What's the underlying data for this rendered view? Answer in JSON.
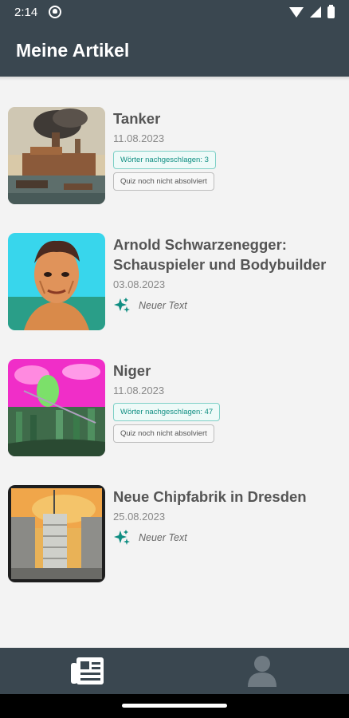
{
  "status_bar": {
    "time": "2:14"
  },
  "app_bar": {
    "title": "Meine Artikel"
  },
  "articles": [
    {
      "title": "Tanker",
      "date": "11.08.2023",
      "lookups": "Wörter nachgeschlagen: 3",
      "quiz": "Quiz noch nicht absolviert"
    },
    {
      "title": "Arnold Schwarzenegger: Schauspieler und Bodybuilder",
      "date": "03.08.2023",
      "new_label": "Neuer Text"
    },
    {
      "title": "Niger",
      "date": "11.08.2023",
      "lookups": "Wörter nachgeschlagen: 47",
      "quiz": "Quiz noch nicht absolviert"
    },
    {
      "title": "Neue Chipfabrik in Dresden",
      "date": "25.08.2023",
      "new_label": "Neuer Text"
    }
  ],
  "bottom_nav": {
    "tabs": [
      {
        "icon": "newspaper-icon",
        "active": true,
        "color": "#ffffff"
      },
      {
        "icon": "person-icon",
        "active": false,
        "color": "#6f7a82"
      }
    ]
  },
  "colors": {
    "bar": "#3a4750",
    "accent_teal": "#0f8e82",
    "background": "#f3f3f3"
  }
}
